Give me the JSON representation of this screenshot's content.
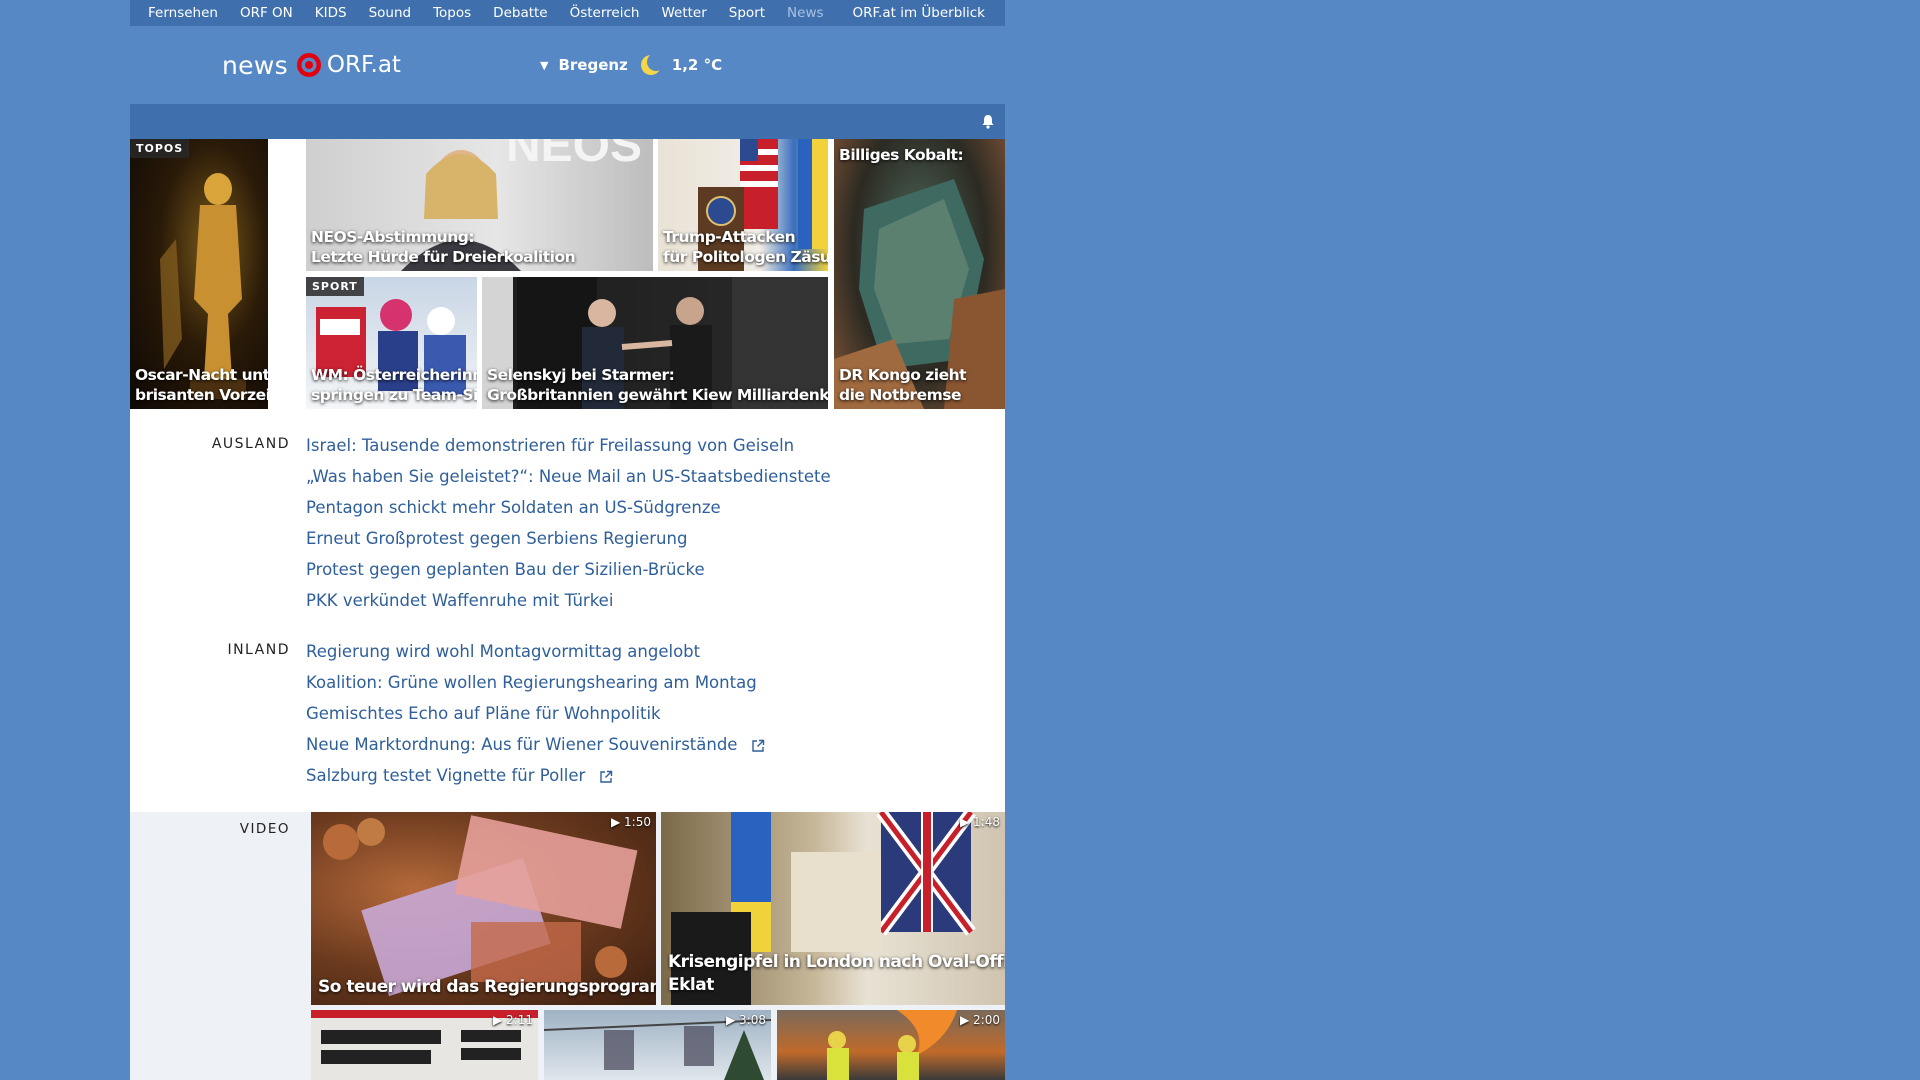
{
  "topnav": {
    "items": [
      "Fernsehen",
      "ORF ON",
      "KIDS",
      "Sound",
      "Topos",
      "Debatte",
      "Österreich",
      "Wetter",
      "Sport",
      "News"
    ],
    "active": "News",
    "overview": "ORF.at im Überblick"
  },
  "brand": {
    "news": "news",
    "orf": "ORF.at"
  },
  "weather": {
    "city": "Bregenz",
    "temp": "1,2 °C"
  },
  "tiles": {
    "oscar": {
      "badge": "TOPOS",
      "caption_1": "Oscar-Nacht unter",
      "caption_2": "brisanten Vorzeichen"
    },
    "neos": {
      "caption_1": "NEOS-Abstimmung:",
      "caption_2": "Letzte Hürde für Dreierkoalition"
    },
    "trump": {
      "caption_1": "Trump-Attacken",
      "caption_2": "für Politologen Zäsur"
    },
    "kobalt": {
      "caption_top": "Billiges Kobalt:",
      "caption_1": "DR Kongo zieht",
      "caption_2": "die Notbremse"
    },
    "ski": {
      "badge": "SPORT",
      "caption_1": "WM: Österreicherinnen",
      "caption_2": "springen zu Team-Silber"
    },
    "selenskyj": {
      "caption_1": "Selenskyj bei Starmer:",
      "caption_2": "Großbritannien gewährt Kiew Milliardenkredit"
    }
  },
  "ausland": {
    "label": "AUSLAND",
    "links": [
      "Israel: Tausende demonstrieren für Freilassung von Geiseln",
      "„Was haben Sie geleistet?“: Neue Mail an US-Staatsbedienstete",
      "Pentagon schickt mehr Soldaten an US-Südgrenze",
      "Erneut Großprotest gegen Serbiens Regierung",
      "Protest gegen geplanten Bau der Sizilien-Brücke",
      "PKK verkündet Waffenruhe mit Türkei"
    ]
  },
  "inland": {
    "label": "INLAND",
    "links": [
      "Regierung wird wohl Montagvormittag angelobt",
      "Koalition: Grüne wollen Regierungshearing am Montag",
      "Gemischtes Echo auf Pläne für Wohnpolitik",
      "Neue Marktordnung: Aus für Wiener Souvenirstände",
      "Salzburg testet Vignette für Poller"
    ]
  },
  "video": {
    "label": "VIDEO",
    "items": [
      {
        "caption": "So teuer wird das Regierungsprogramm",
        "duration": "1:50"
      },
      {
        "caption_1": "Krisengipfel in London nach Oval-Office-",
        "caption_2": "Eklat",
        "duration": "1:48"
      },
      {
        "duration": "2:11"
      },
      {
        "duration": "3:08"
      },
      {
        "duration": "2:00"
      }
    ]
  },
  "colors": {
    "page_bg": "#5588c4",
    "nav_bg": "#3f70ad",
    "link": "#2f5f9a",
    "brand_red": "#e3000f"
  }
}
